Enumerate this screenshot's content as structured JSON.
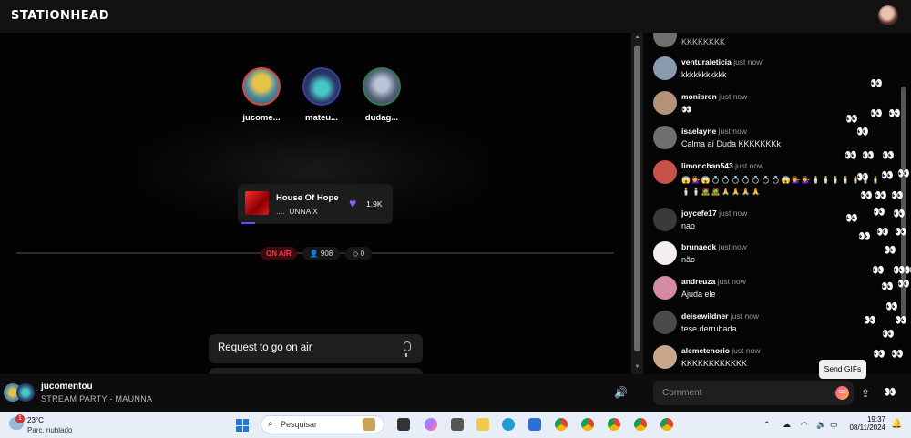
{
  "app": {
    "logo": "STATIONHEAD"
  },
  "hosts": [
    {
      "name": "jucome...",
      "ring": "#e0443e",
      "img": "#4a8aa6"
    },
    {
      "name": "mateu...",
      "ring": "#3b3f9e",
      "img": "#2a3d6a"
    },
    {
      "name": "dudag...",
      "ring": "#2f7a55",
      "img": "#5b6a80"
    }
  ],
  "track": {
    "title": "House Of Hope",
    "artist": "UNNA X",
    "artist_icon": "....",
    "likes": "1.9K"
  },
  "status": {
    "on_air": "ON AIR",
    "listeners": "908",
    "diamonds": "0"
  },
  "request": {
    "label": "Request to go on air"
  },
  "player": {
    "title": "jucomentou",
    "subtitle": "STREAM PARTY - MAUNNA"
  },
  "chat": {
    "partial_top": "KKKKKKKK",
    "time_label": "just now",
    "messages": [
      {
        "user": "venturaleticia",
        "text": "kkkkkkkkkkk",
        "av": "#8a9bb0"
      },
      {
        "user": "monibren",
        "text": "👀",
        "av": "#b5917a"
      },
      {
        "user": "isaelayne",
        "text": "Calma aí Duda KKKKKKKk",
        "av": "#6f6f6f"
      },
      {
        "user": "limonchan543",
        "text": "😱💁‍♀️😱💍💍💍💍💍💍💍😱💁‍♀️💁‍♀️🕯️🕯️🕯️🕯️🕯️🕯️🕯️🕯️🕯️🧟🧟🙏🙏🙏🙏",
        "av": "#c8514a",
        "emoji": true
      },
      {
        "user": "joycefe17",
        "text": "nao",
        "av": "#3a3a3a"
      },
      {
        "user": "brunaedk",
        "text": "não",
        "av": "#f5eef0"
      },
      {
        "user": "andreuza",
        "text": "Ajuda ele",
        "av": "#d48aa0"
      },
      {
        "user": "deisewildner",
        "text": "tese derrubada",
        "av": "#4a4a4a"
      },
      {
        "user": "alemctenorio",
        "text": "KKKKKKKKKKKK",
        "av": "#c9a68a"
      }
    ],
    "eyes": "👀",
    "comment_placeholder": "Comment",
    "gif_label": "GIF",
    "tooltip": "Send GIFs"
  },
  "taskbar": {
    "weather_badge": "1",
    "temperature": "23°C",
    "condition": "Parc. nublado",
    "search_placeholder": "Pesquisar",
    "time": "19:37",
    "date": "08/11/2024"
  }
}
